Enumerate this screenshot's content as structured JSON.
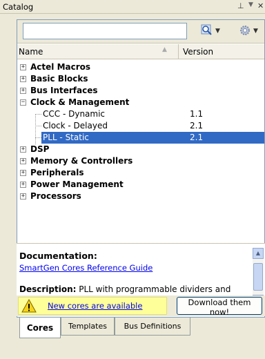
{
  "window": {
    "title": "Catalog",
    "pin_glyph": "⊥",
    "dropdown_glyph": "▼",
    "close_glyph": "✕"
  },
  "toolbar": {
    "search_value": "",
    "search_placeholder": "",
    "search_icon": "search-icon",
    "settings_icon": "gear-icon"
  },
  "columns": {
    "name": "Name",
    "version": "Version"
  },
  "tree": {
    "actel": "Actel Macros",
    "basic": "Basic Blocks",
    "bus": "Bus Interfaces",
    "clock": "Clock & Management",
    "ccc_label": "CCC - Dynamic",
    "ccc_version": "1.1",
    "delayed_label": "Clock - Delayed",
    "delayed_version": "2.1",
    "pll_label": "PLL - Static",
    "pll_version": "2.1",
    "dsp": "DSP",
    "memory": "Memory & Controllers",
    "peripherals": "Peripherals",
    "power": "Power Management",
    "processors": "Processors"
  },
  "documentation": {
    "title": "Documentation:",
    "link": "SmartGen Cores Reference Guide",
    "desc_label": "Description:",
    "desc_text": " PLL with programmable dividers and delays"
  },
  "notification": {
    "link": "New cores are available",
    "button": "Download them now!"
  },
  "tabs": {
    "cores": "Cores",
    "templates": "Templates",
    "bus": "Bus Definitions"
  },
  "colors": {
    "selection": "#316ac5",
    "link": "#0000ee",
    "warning_bg": "#ffff99"
  }
}
